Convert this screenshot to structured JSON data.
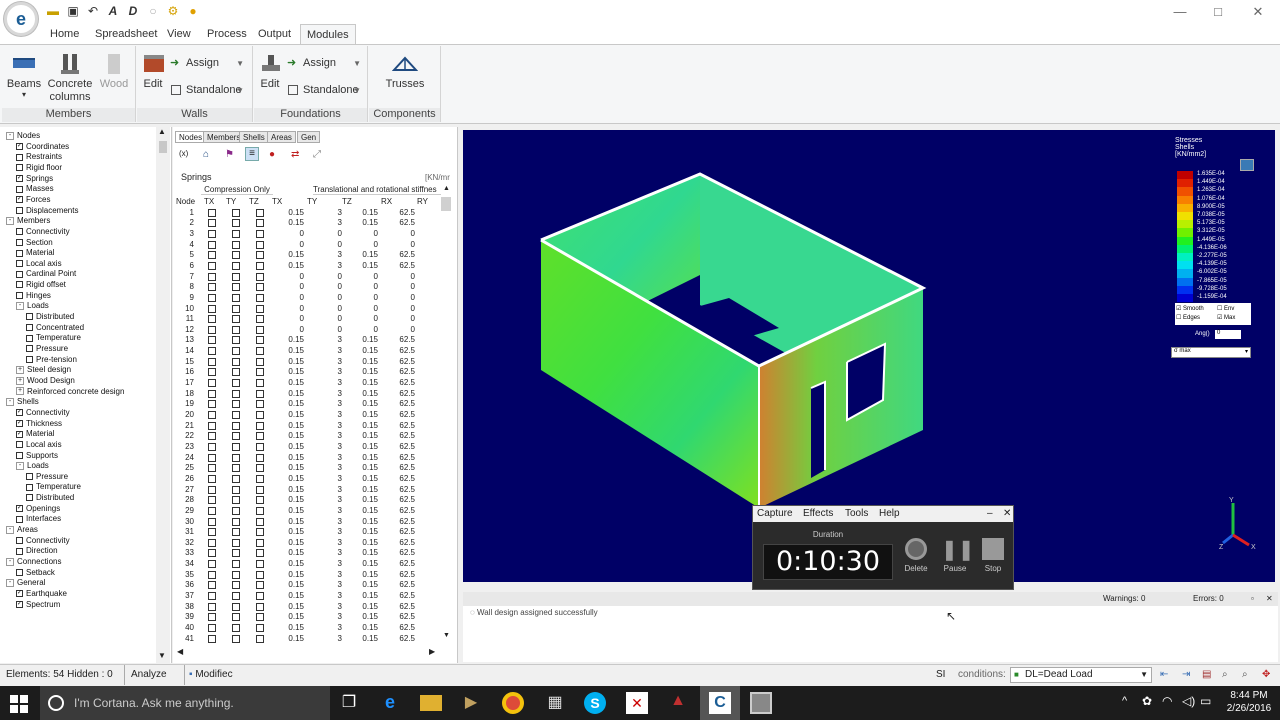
{
  "ribbon_tabs": [
    "Home",
    "Spreadsheet",
    "View",
    "Process",
    "Output",
    "Modules"
  ],
  "groups": {
    "members": {
      "label": "Members",
      "beams": "Beams",
      "concrete": "Concrete\ncolumns",
      "wood": "Wood"
    },
    "walls": {
      "label": "Walls",
      "edit": "Edit",
      "assign": "Assign",
      "standalone": "Standalone"
    },
    "foundations": {
      "label": "Foundations",
      "edit": "Edit",
      "assign": "Assign",
      "standalone": "Standalone"
    },
    "components": {
      "label": "Components",
      "trusses": "Trusses"
    }
  },
  "tree": [
    {
      "t": "Nodes",
      "lvl": 0,
      "exp": "-"
    },
    {
      "t": "Coordinates",
      "lvl": 1,
      "cb": true
    },
    {
      "t": "Restraints",
      "lvl": 1,
      "cb": false
    },
    {
      "t": "Rigid floor",
      "lvl": 1,
      "cb": false
    },
    {
      "t": "Springs",
      "lvl": 1,
      "cb": true
    },
    {
      "t": "Masses",
      "lvl": 1,
      "cb": false
    },
    {
      "t": "Forces",
      "lvl": 1,
      "cb": true
    },
    {
      "t": "Displacements",
      "lvl": 1,
      "cb": false
    },
    {
      "t": "Members",
      "lvl": 0,
      "exp": "-"
    },
    {
      "t": "Connectivity",
      "lvl": 1,
      "cb": false
    },
    {
      "t": "Section",
      "lvl": 1,
      "cb": false
    },
    {
      "t": "Material",
      "lvl": 1,
      "cb": false
    },
    {
      "t": "Local axis",
      "lvl": 1,
      "cb": false
    },
    {
      "t": "Cardinal Point",
      "lvl": 1,
      "cb": false
    },
    {
      "t": "Rigid offset",
      "lvl": 1,
      "cb": false
    },
    {
      "t": "Hinges",
      "lvl": 1,
      "cb": false
    },
    {
      "t": "Loads",
      "lvl": 1,
      "exp": "-"
    },
    {
      "t": "Distributed",
      "lvl": 2,
      "cb": false
    },
    {
      "t": "Concentrated",
      "lvl": 2,
      "cb": false
    },
    {
      "t": "Temperature",
      "lvl": 2,
      "cb": false
    },
    {
      "t": "Pressure",
      "lvl": 2,
      "cb": false
    },
    {
      "t": "Pre-tension",
      "lvl": 2,
      "cb": false
    },
    {
      "t": "Steel design",
      "lvl": 1,
      "exp": "+"
    },
    {
      "t": "Wood Design",
      "lvl": 1,
      "exp": "+"
    },
    {
      "t": "Reinforced concrete design",
      "lvl": 1,
      "exp": "+"
    },
    {
      "t": "Shells",
      "lvl": 0,
      "exp": "-"
    },
    {
      "t": "Connectivity",
      "lvl": 1,
      "cb": true
    },
    {
      "t": "Thickness",
      "lvl": 1,
      "cb": true
    },
    {
      "t": "Material",
      "lvl": 1,
      "cb": true
    },
    {
      "t": "Local axis",
      "lvl": 1,
      "cb": false
    },
    {
      "t": "Supports",
      "lvl": 1,
      "cb": false
    },
    {
      "t": "Loads",
      "lvl": 1,
      "exp": "-"
    },
    {
      "t": "Pressure",
      "lvl": 2,
      "cb": false
    },
    {
      "t": "Temperature",
      "lvl": 2,
      "cb": false
    },
    {
      "t": "Distributed",
      "lvl": 2,
      "cb": false
    },
    {
      "t": "Openings",
      "lvl": 1,
      "cb": true
    },
    {
      "t": "Interfaces",
      "lvl": 1,
      "cb": false
    },
    {
      "t": "Areas",
      "lvl": 0,
      "exp": "-"
    },
    {
      "t": "Connectivity",
      "lvl": 1,
      "cb": false
    },
    {
      "t": "Direction",
      "lvl": 1,
      "cb": false
    },
    {
      "t": "Connections",
      "lvl": 0,
      "exp": "-"
    },
    {
      "t": "Setback",
      "lvl": 1,
      "cb": false
    },
    {
      "t": "General",
      "lvl": 0,
      "exp": "-"
    },
    {
      "t": "Earthquake",
      "lvl": 1,
      "cb": true
    },
    {
      "t": "Spectrum",
      "lvl": 1,
      "cb": true
    }
  ],
  "panel": {
    "tabs": [
      "Nodes",
      "Members",
      "Shells",
      "Areas",
      "Gen"
    ],
    "title": "Springs",
    "units": "[KN/mr",
    "group1": "Compression Only",
    "group2": "Translational and rotational stiffnes",
    "headers": [
      "Node",
      "TX",
      "TY",
      "TZ",
      "TX",
      "TY",
      "TZ",
      "RX",
      "RY"
    ],
    "rows": [
      [
        "1",
        "0.15",
        "3",
        "0.15",
        "62.5"
      ],
      [
        "2",
        "0.15",
        "3",
        "0.15",
        "62.5"
      ],
      [
        "3",
        "0",
        "0",
        "0",
        "0"
      ],
      [
        "4",
        "0",
        "0",
        "0",
        "0"
      ],
      [
        "5",
        "0.15",
        "3",
        "0.15",
        "62.5"
      ],
      [
        "6",
        "0.15",
        "3",
        "0.15",
        "62.5"
      ],
      [
        "7",
        "0",
        "0",
        "0",
        "0"
      ],
      [
        "8",
        "0",
        "0",
        "0",
        "0"
      ],
      [
        "9",
        "0",
        "0",
        "0",
        "0"
      ],
      [
        "10",
        "0",
        "0",
        "0",
        "0"
      ],
      [
        "11",
        "0",
        "0",
        "0",
        "0"
      ],
      [
        "12",
        "0",
        "0",
        "0",
        "0"
      ],
      [
        "13",
        "0.15",
        "3",
        "0.15",
        "62.5"
      ],
      [
        "14",
        "0.15",
        "3",
        "0.15",
        "62.5"
      ],
      [
        "15",
        "0.15",
        "3",
        "0.15",
        "62.5"
      ],
      [
        "16",
        "0.15",
        "3",
        "0.15",
        "62.5"
      ],
      [
        "17",
        "0.15",
        "3",
        "0.15",
        "62.5"
      ],
      [
        "18",
        "0.15",
        "3",
        "0.15",
        "62.5"
      ],
      [
        "19",
        "0.15",
        "3",
        "0.15",
        "62.5"
      ],
      [
        "20",
        "0.15",
        "3",
        "0.15",
        "62.5"
      ],
      [
        "21",
        "0.15",
        "3",
        "0.15",
        "62.5"
      ],
      [
        "22",
        "0.15",
        "3",
        "0.15",
        "62.5"
      ],
      [
        "23",
        "0.15",
        "3",
        "0.15",
        "62.5"
      ],
      [
        "24",
        "0.15",
        "3",
        "0.15",
        "62.5"
      ],
      [
        "25",
        "0.15",
        "3",
        "0.15",
        "62.5"
      ],
      [
        "26",
        "0.15",
        "3",
        "0.15",
        "62.5"
      ],
      [
        "27",
        "0.15",
        "3",
        "0.15",
        "62.5"
      ],
      [
        "28",
        "0.15",
        "3",
        "0.15",
        "62.5"
      ],
      [
        "29",
        "0.15",
        "3",
        "0.15",
        "62.5"
      ],
      [
        "30",
        "0.15",
        "3",
        "0.15",
        "62.5"
      ],
      [
        "31",
        "0.15",
        "3",
        "0.15",
        "62.5"
      ],
      [
        "32",
        "0.15",
        "3",
        "0.15",
        "62.5"
      ],
      [
        "33",
        "0.15",
        "3",
        "0.15",
        "62.5"
      ],
      [
        "34",
        "0.15",
        "3",
        "0.15",
        "62.5"
      ],
      [
        "35",
        "0.15",
        "3",
        "0.15",
        "62.5"
      ],
      [
        "36",
        "0.15",
        "3",
        "0.15",
        "62.5"
      ],
      [
        "37",
        "0.15",
        "3",
        "0.15",
        "62.5"
      ],
      [
        "38",
        "0.15",
        "3",
        "0.15",
        "62.5"
      ],
      [
        "39",
        "0.15",
        "3",
        "0.15",
        "62.5"
      ],
      [
        "40",
        "0.15",
        "3",
        "0.15",
        "62.5"
      ],
      [
        "41",
        "0.15",
        "3",
        "0.15",
        "62.5"
      ]
    ]
  },
  "legend": {
    "title1": "Stresses",
    "title2": "Shells",
    "title3": "[KN/mm2]",
    "values": [
      "1.635E-04",
      "1.449E-04",
      "1.263E-04",
      "1.076E-04",
      "8.900E-05",
      "7.038E-05",
      "5.173E-05",
      "3.312E-05",
      "1.449E-05",
      "-4.136E-06",
      "-2.277E-05",
      "-4.139E-05",
      "-6.002E-05",
      "-7.865E-05",
      "-9.728E-05",
      "-1.159E-04"
    ],
    "colors": [
      "#c00000",
      "#e02000",
      "#f05000",
      "#f88000",
      "#f8b000",
      "#f0e000",
      "#b8f000",
      "#70f000",
      "#20f020",
      "#00f070",
      "#00f0c0",
      "#00e0f0",
      "#00b0f0",
      "#0070f0",
      "#0030f0",
      "#0000d0"
    ],
    "smooth": "Smooth",
    "edges": "Edges",
    "env": "Env",
    "max": "Max",
    "ang_label": "Ang()",
    "ang_value": "0",
    "select": "σ max"
  },
  "recorder": {
    "menu": [
      "Capture",
      "Effects",
      "Tools",
      "Help"
    ],
    "duration_label": "Duration",
    "time": "0:10:30",
    "delete": "Delete",
    "pause": "Pause",
    "stop": "Stop"
  },
  "output": {
    "message": "Wall design assigned successfully",
    "warnings": "Warnings: 0",
    "errors": "Errors: 0"
  },
  "status": {
    "elements": "Elements: 54  Hidden : 0",
    "analyze": "Analyze",
    "modified": "Modifiec",
    "si": "SI",
    "conditions": "conditions:",
    "load": "DL=Dead Load"
  },
  "taskbar": {
    "cortana": "I'm Cortana. Ask me anything.",
    "time": "8:44 PM",
    "date": "2/26/2016"
  }
}
